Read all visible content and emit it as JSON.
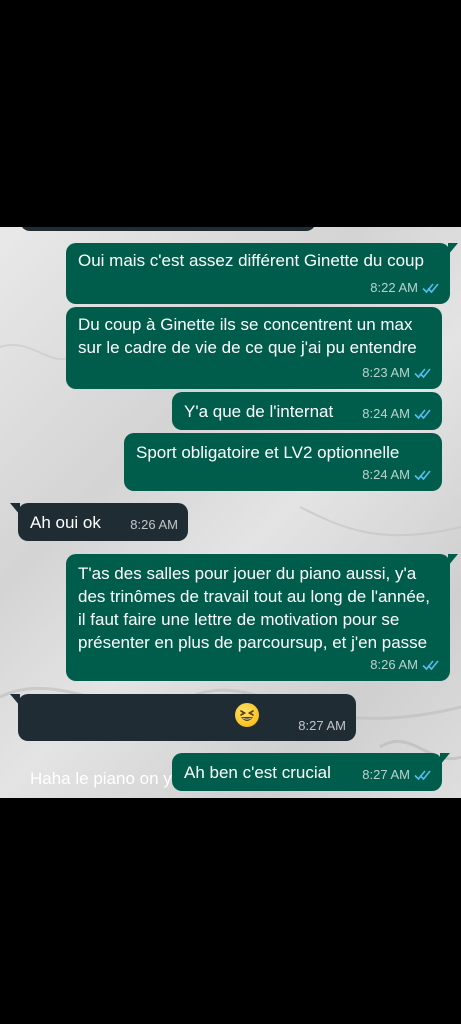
{
  "colors": {
    "outgoing": "#005c4b",
    "incoming": "#1f2c34",
    "read_ticks": "#53bdeb"
  },
  "messages": [
    {
      "direction": "out",
      "text": "Oui mais c'est assez différent Ginette du coup",
      "time": "8:22 AM",
      "status": "read"
    },
    {
      "direction": "out",
      "text": "Du coup à Ginette ils se concentrent un max sur le cadre de vie de ce que j'ai pu entendre",
      "time": "8:23 AM",
      "status": "read"
    },
    {
      "direction": "out",
      "text": "Y'a que de l'internat",
      "time": "8:24 AM",
      "status": "read"
    },
    {
      "direction": "out",
      "text": "Sport obligatoire et LV2 optionnelle",
      "time": "8:24 AM",
      "status": "read"
    },
    {
      "direction": "in",
      "text": "Ah oui ok",
      "time": "8:26 AM"
    },
    {
      "direction": "out",
      "text": "T'as des salles pour jouer du piano aussi, y'a des trinômes de travail tout au long de l'année, il faut faire une lettre de motivation pour se présenter en plus de parcoursup, et j'en passe",
      "time": "8:26 AM",
      "status": "read"
    },
    {
      "direction": "in",
      "text": "Haha le piano on y revient",
      "emoji": "grinning-squinting-face-icon",
      "time": "8:27 AM"
    },
    {
      "direction": "out",
      "text": "Ah ben c'est crucial",
      "time": "8:27 AM",
      "status": "read"
    }
  ]
}
